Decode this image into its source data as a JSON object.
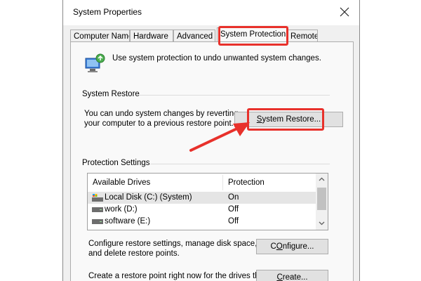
{
  "window": {
    "title": "System Properties"
  },
  "tabs": [
    {
      "label": "Computer Name"
    },
    {
      "label": "Hardware"
    },
    {
      "label": "Advanced"
    },
    {
      "label": "System Protection"
    },
    {
      "label": "Remote"
    }
  ],
  "active_tab": "System Protection",
  "intro": {
    "text": "Use system protection to undo unwanted system changes."
  },
  "system_restore": {
    "group_title": "System Restore",
    "description_line1": "You can undo system changes by reverting",
    "description_line2": "your computer to a previous restore point.",
    "button_underlined": "S",
    "button_rest": "ystem Restore..."
  },
  "protection": {
    "group_title": "Protection Settings",
    "columns": [
      "Available Drives",
      "Protection"
    ],
    "drives": [
      {
        "name": "Local Disk (C:) (System)",
        "protection": "On",
        "icon": "system-drive-icon",
        "selected": true
      },
      {
        "name": "work (D:)",
        "protection": "Off",
        "icon": "drive-icon",
        "selected": false
      },
      {
        "name": "software (E:)",
        "protection": "Off",
        "icon": "drive-icon",
        "selected": false
      }
    ]
  },
  "configure": {
    "description_line1": "Configure restore settings, manage disk space,",
    "description_line2": "and delete restore points.",
    "button_underlined": "O",
    "button_before": "C",
    "button_rest": "nfigure..."
  },
  "create": {
    "description_line1": "Create a restore point right now for the drives that",
    "button_underlined": "C",
    "button_rest": "reate..."
  },
  "colors": {
    "highlight": "#e8312b",
    "dialog_bg": "#f0f0f0",
    "panel_bg": "#f9f9f9"
  }
}
